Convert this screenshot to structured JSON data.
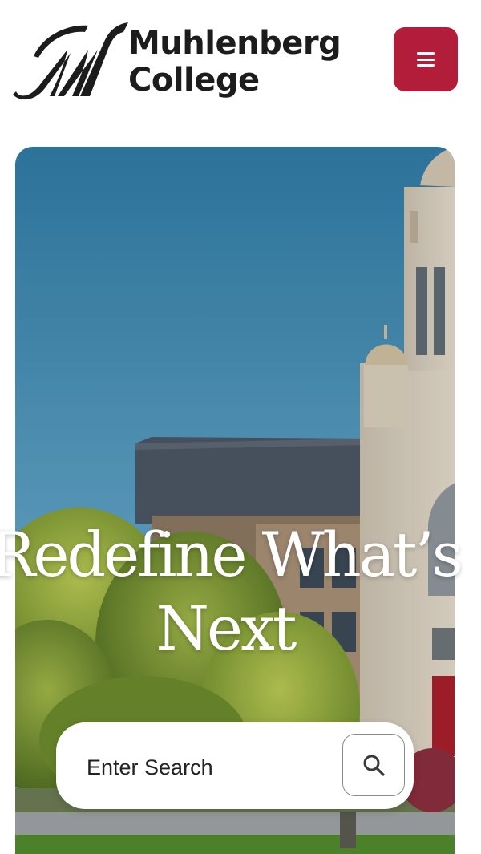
{
  "header": {
    "logo_line1": "Muhlenberg",
    "logo_line2": "College",
    "logo_icon": "m-script-logo",
    "menu_icon": "hamburger-icon",
    "brand_color": "#b21d3a"
  },
  "hero": {
    "headline": "Redefine What’s Next",
    "image": "campus-chapel-photo"
  },
  "search": {
    "placeholder": "Enter Search",
    "icon": "search-icon"
  }
}
